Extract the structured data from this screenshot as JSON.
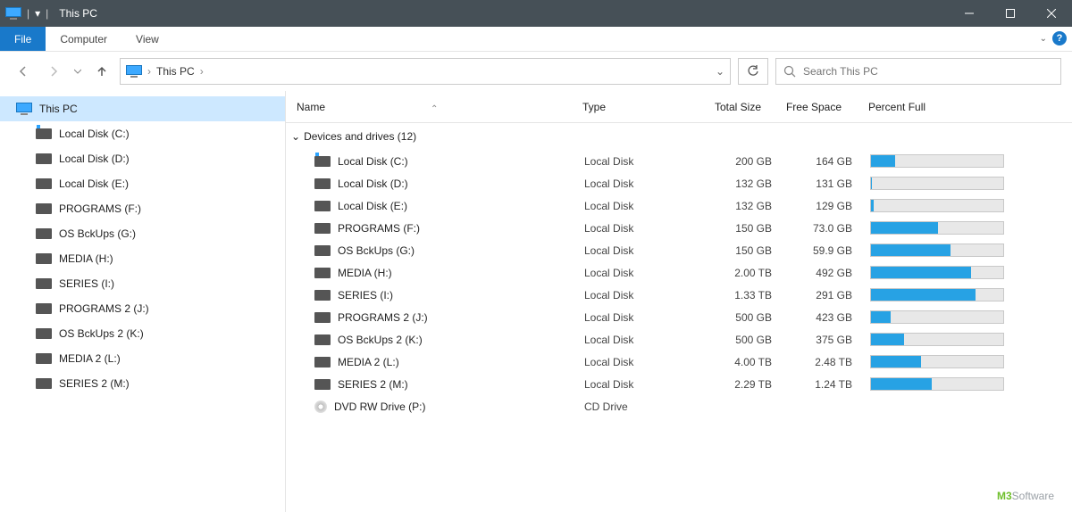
{
  "titlebar": {
    "title": "This PC"
  },
  "tabs": {
    "file": "File",
    "computer": "Computer",
    "view": "View"
  },
  "breadcrumb": {
    "location": "This PC"
  },
  "search": {
    "placeholder": "Search This PC"
  },
  "sidebar": {
    "root": "This PC",
    "items": [
      {
        "label": "Local Disk (C:)",
        "sys": true
      },
      {
        "label": "Local Disk (D:)"
      },
      {
        "label": "Local Disk (E:)"
      },
      {
        "label": "PROGRAMS (F:)"
      },
      {
        "label": "OS BckUps (G:)"
      },
      {
        "label": "MEDIA (H:)"
      },
      {
        "label": "SERIES (I:)"
      },
      {
        "label": "PROGRAMS 2 (J:)"
      },
      {
        "label": "OS BckUps 2 (K:)"
      },
      {
        "label": "MEDIA 2 (L:)"
      },
      {
        "label": "SERIES 2 (M:)"
      }
    ]
  },
  "columns": {
    "name": "Name",
    "type": "Type",
    "total": "Total Size",
    "free": "Free Space",
    "pct": "Percent Full"
  },
  "group": {
    "title": "Devices and drives (12)"
  },
  "drives": [
    {
      "name": "Local Disk (C:)",
      "type": "Local Disk",
      "total": "200 GB",
      "free": "164 GB",
      "pct": 18,
      "sys": true
    },
    {
      "name": "Local Disk (D:)",
      "type": "Local Disk",
      "total": "132 GB",
      "free": "131 GB",
      "pct": 1
    },
    {
      "name": "Local Disk (E:)",
      "type": "Local Disk",
      "total": "132 GB",
      "free": "129 GB",
      "pct": 2
    },
    {
      "name": "PROGRAMS (F:)",
      "type": "Local Disk",
      "total": "150 GB",
      "free": "73.0 GB",
      "pct": 51
    },
    {
      "name": "OS BckUps (G:)",
      "type": "Local Disk",
      "total": "150 GB",
      "free": "59.9 GB",
      "pct": 60
    },
    {
      "name": "MEDIA (H:)",
      "type": "Local Disk",
      "total": "2.00 TB",
      "free": "492 GB",
      "pct": 76
    },
    {
      "name": "SERIES (I:)",
      "type": "Local Disk",
      "total": "1.33 TB",
      "free": "291 GB",
      "pct": 79
    },
    {
      "name": "PROGRAMS 2 (J:)",
      "type": "Local Disk",
      "total": "500 GB",
      "free": "423 GB",
      "pct": 15
    },
    {
      "name": "OS BckUps 2 (K:)",
      "type": "Local Disk",
      "total": "500 GB",
      "free": "375 GB",
      "pct": 25
    },
    {
      "name": "MEDIA 2 (L:)",
      "type": "Local Disk",
      "total": "4.00 TB",
      "free": "2.48 TB",
      "pct": 38
    },
    {
      "name": "SERIES 2 (M:)",
      "type": "Local Disk",
      "total": "2.29 TB",
      "free": "1.24 TB",
      "pct": 46
    },
    {
      "name": "DVD RW Drive (P:)",
      "type": "CD Drive",
      "total": "",
      "free": "",
      "pct": null,
      "dvd": true
    }
  ],
  "watermark": {
    "m": "M3",
    "sw": "Software"
  }
}
